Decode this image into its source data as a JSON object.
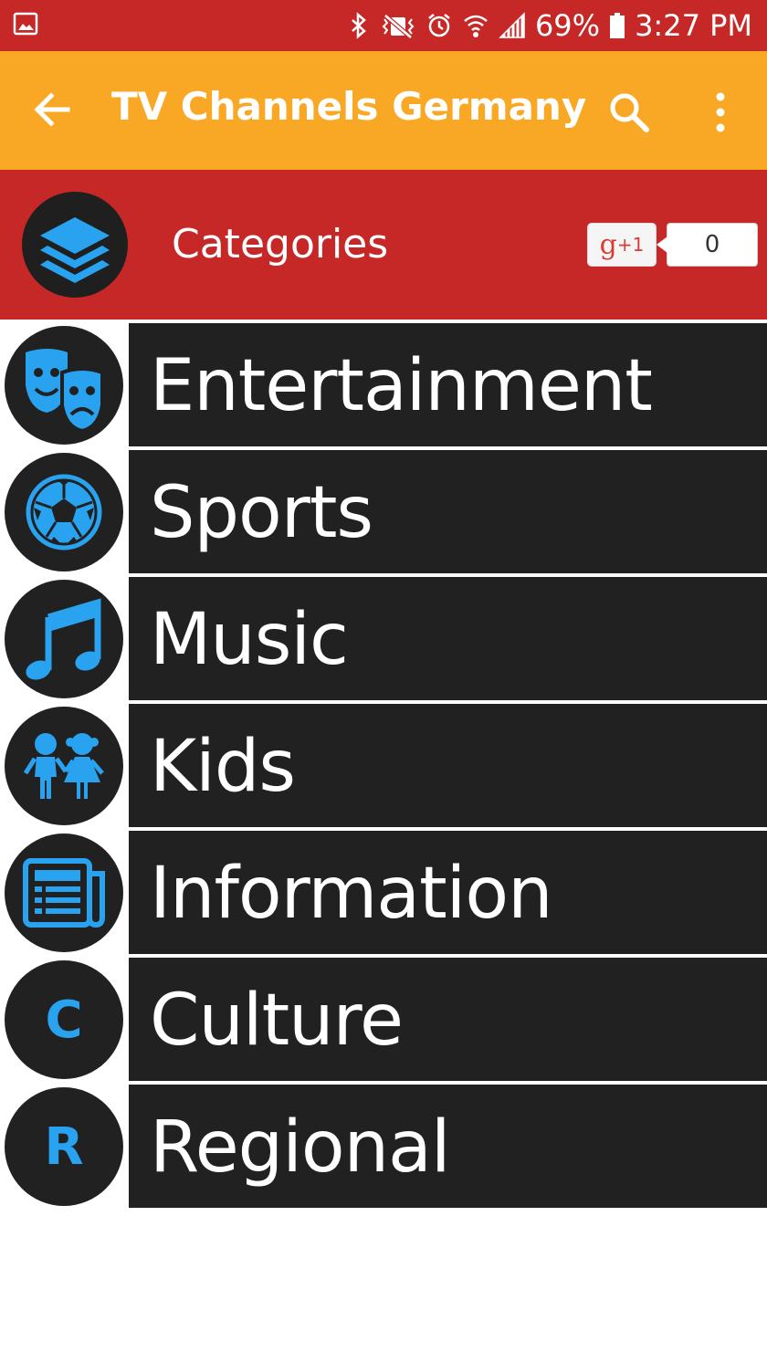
{
  "status_bar": {
    "battery": "69%",
    "time": "3:27 PM"
  },
  "app_bar": {
    "title": "TV Channels Germany"
  },
  "header": {
    "title": "Categories",
    "gplus_label": "g",
    "gplus_sup": "+1",
    "gplus_count": "0"
  },
  "categories": [
    {
      "label": "Entertainment",
      "icon": "theater-masks-icon"
    },
    {
      "label": "Sports",
      "icon": "soccer-ball-icon"
    },
    {
      "label": "Music",
      "icon": "music-note-icon"
    },
    {
      "label": "Kids",
      "icon": "kids-icon"
    },
    {
      "label": "Information",
      "icon": "newspaper-icon"
    },
    {
      "label": "Culture",
      "icon": "culture-letter-icon",
      "letter": "C"
    },
    {
      "label": "Regional",
      "icon": "regional-letter-icon",
      "letter": "R"
    }
  ],
  "colors": {
    "status_bar": "#c62828",
    "app_bar": "#f9a825",
    "header": "#c62828",
    "row_bg": "#212121",
    "icon_accent": "#29a3ef"
  }
}
